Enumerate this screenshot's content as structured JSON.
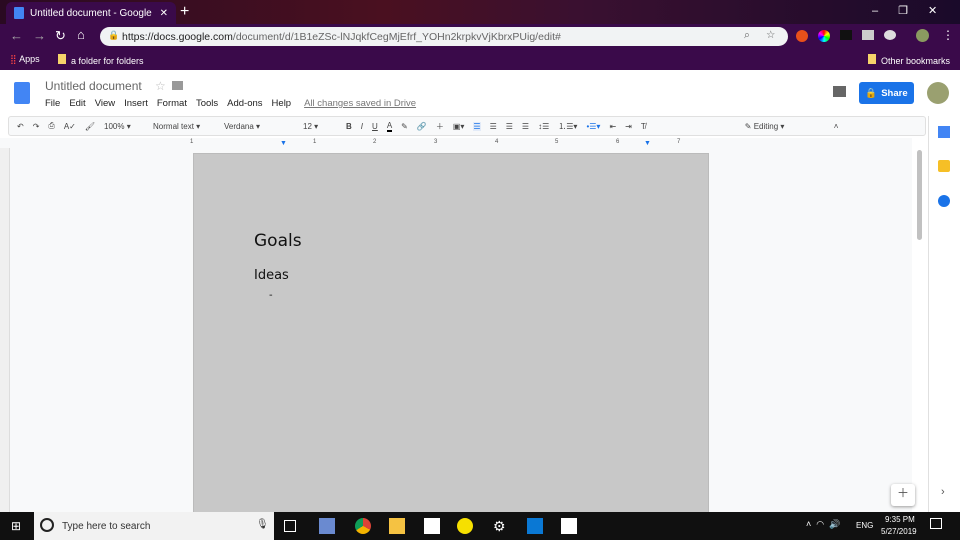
{
  "browser": {
    "tab_title": "Untitled document - Google Doc",
    "url_host": "https://docs.google.com",
    "url_path": "/document/d/1B1eZSc-lNJqkfCegMjEfrf_YOHn2krpkvVjKbrxPUig/edit#",
    "bookmarks": {
      "apps": "Apps",
      "folder": "a folder for folders",
      "other": "Other bookmarks"
    }
  },
  "doc": {
    "title": "Untitled document",
    "menus": [
      "File",
      "Edit",
      "View",
      "Insert",
      "Format",
      "Tools",
      "Add-ons",
      "Help"
    ],
    "save_status": "All changes saved in Drive",
    "share": "Share"
  },
  "toolbar": {
    "zoom": "100%",
    "style": "Normal text",
    "font": "Verdana",
    "size": "12",
    "mode": "Editing"
  },
  "ruler": [
    "1",
    "1",
    "2",
    "3",
    "4",
    "5",
    "6",
    "7"
  ],
  "content": {
    "heading": "Goals",
    "subheading": "Ideas",
    "bullet": "-"
  },
  "taskbar": {
    "search": "Type here to search",
    "lang": "ENG",
    "time": "9:35 PM",
    "date": "5/27/2019"
  },
  "colors": {
    "accent": "#1a73e8",
    "chrome": "#3a0a4a"
  }
}
